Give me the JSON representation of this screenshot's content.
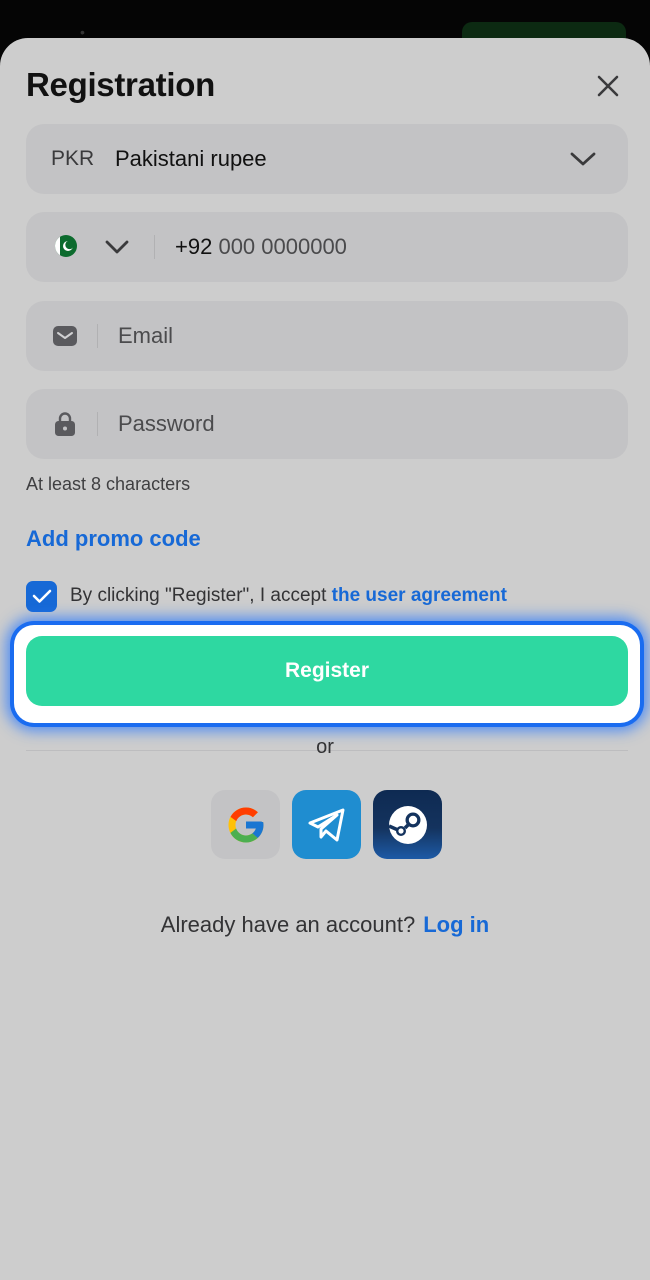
{
  "dialog": {
    "title": "Registration"
  },
  "currency": {
    "code": "PKR",
    "name": "Pakistani rupee"
  },
  "phone": {
    "prefix": "+92",
    "placeholder": "000 0000000"
  },
  "email": {
    "placeholder": "Email"
  },
  "password": {
    "placeholder": "Password",
    "hint": "At least 8 characters"
  },
  "promo": {
    "label": "Add promo code"
  },
  "agreement": {
    "checked": true,
    "text": "By clicking \"Register\", I accept ",
    "link": "the user agreement"
  },
  "register": {
    "label": "Register"
  },
  "divider": {
    "label": "or"
  },
  "social": {
    "icons": [
      "google-icon",
      "telegram-icon",
      "steam-icon"
    ]
  },
  "login": {
    "prompt": "Already have an account?",
    "link": "Log in"
  },
  "colors": {
    "accent": "#1769d6",
    "register_button": "#2ed8a1",
    "highlight": "#1a6cf0"
  }
}
